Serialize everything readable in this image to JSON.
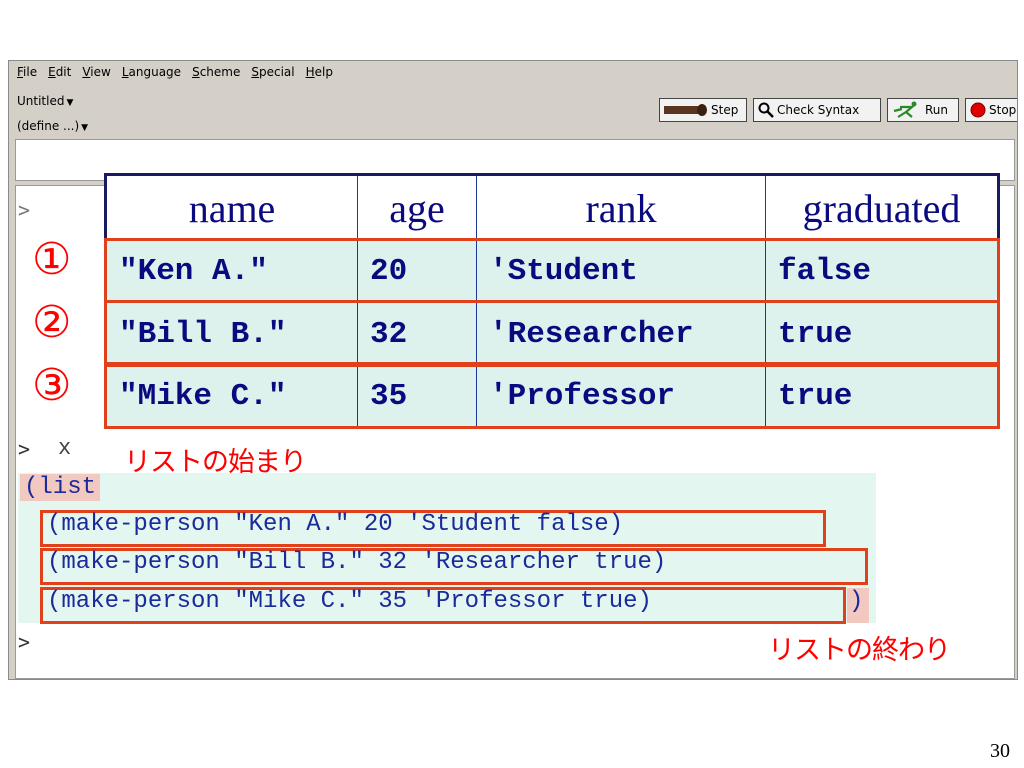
{
  "menu": [
    "File",
    "Edit",
    "View",
    "Language",
    "Scheme",
    "Special",
    "Help"
  ],
  "dropdowns": {
    "file_name": "Untitled",
    "define": "(define ...)"
  },
  "toolbar": {
    "step": "Step",
    "check_syntax": "Check Syntax",
    "run": "Run",
    "stop": "Stop"
  },
  "table": {
    "headers": [
      "name",
      "age",
      "rank",
      "graduated"
    ],
    "rows": [
      [
        "\"Ken A.\"",
        "20",
        "'Student",
        "false"
      ],
      [
        "\"Bill B.\"",
        "32",
        "'Researcher",
        "true"
      ],
      [
        "\"Mike C.\"",
        "35",
        "'Professor",
        "true"
      ]
    ],
    "row_numbers": [
      "①",
      "②",
      "③"
    ]
  },
  "repl": {
    "prompt": ">",
    "input": "x",
    "list_open": "(list",
    "entries": [
      "(make-person \"Ken A.\" 20 'Student false)",
      "(make-person \"Bill B.\" 32 'Researcher true)",
      "(make-person \"Mike C.\" 35 'Professor true)"
    ],
    "list_close": ")"
  },
  "annotations": {
    "list_start": "リストの始まり",
    "list_end": "リストの終わり"
  },
  "page_number": "30",
  "colors": {
    "accent": "#e0401a",
    "annotation": "#ff0000",
    "code": "#1a2a9a",
    "table_bg": "#ddf2ec",
    "list_bg": "#e3f6ef"
  }
}
